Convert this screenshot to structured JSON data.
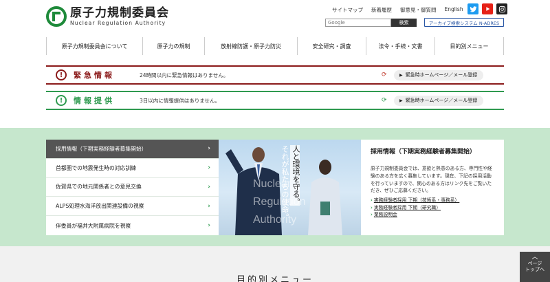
{
  "site": {
    "name_ja": "原子力規制委員会",
    "name_en": "Nuclear Regulation Authority"
  },
  "utility_links": [
    "サイトマップ",
    "新着履歴",
    "御意見・御質問",
    "English"
  ],
  "social": [
    "twitter-icon",
    "youtube-icon",
    "instagram-icon"
  ],
  "search": {
    "placeholder": "Google",
    "button": "検索"
  },
  "archive_button": "アーカイブ検索システム N-ADRES",
  "nav": [
    "原子力規制委員会について",
    "原子力の規制",
    "放射線防護・原子力防災",
    "安全研究・調査",
    "法令・手続・文書",
    "目的別メニュー"
  ],
  "alerts": {
    "emergency": {
      "title": "緊急情報",
      "message": "24時間以内に緊急情報はありません。",
      "link": "緊急時ホームページ／メール登録",
      "color": "#8b1a1a"
    },
    "info": {
      "title": "情報提供",
      "message": "3日以内に情報提供はありません。",
      "link": "緊急時ホームページ／メール登録",
      "color": "#2f9a4f"
    }
  },
  "news": [
    "採用情報（下期実務経験者募集開始）",
    "首都圏での地震発生時の対応訓練",
    "佐賀県での地元関係者との意見交換",
    "ALPS処理水海洋放出関連設備の視察",
    "伴委員が福井大附属病院を視察"
  ],
  "photo": {
    "caption_col1": "人と環境を守る。",
    "caption_col2": "それが私たちの使命。",
    "watermark": [
      "Nuclear",
      "Regulation",
      "Authority"
    ]
  },
  "feature": {
    "title": "採用情報（下期実務経験者募集開始）",
    "text": "原子力規制委員会では、意欲と熱意のある方、専門性や経験のある方を広く募集しています。現在、下記の採用活動を行っていますので、関心のある方はリンク先をご覧いただき、ぜひご応募ください。",
    "links": [
      "実務経験者採用 下期（技術系・事務系）",
      "実務経験者採用 下期（研究職）",
      "業務説明会"
    ]
  },
  "bottom_title": "目的別メニュー",
  "page_top": [
    "ページ",
    "トップへ"
  ]
}
